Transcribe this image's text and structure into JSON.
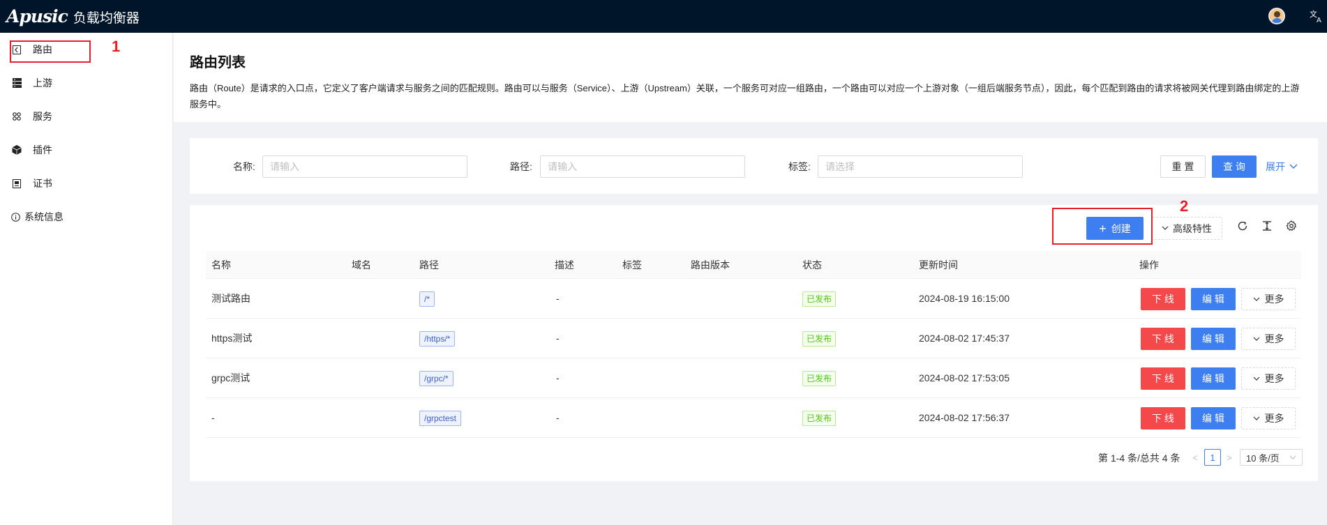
{
  "app": {
    "logo": "Apusic",
    "name": "负载均衡器"
  },
  "header_icons": {
    "avatar": "user-avatar",
    "language": "translate-icon"
  },
  "sidebar": {
    "items": [
      {
        "label": "路由",
        "icon": "route-icon"
      },
      {
        "label": "上游",
        "icon": "server-stack-icon"
      },
      {
        "label": "服务",
        "icon": "apps-icon"
      },
      {
        "label": "插件",
        "icon": "cube-icon"
      },
      {
        "label": "证书",
        "icon": "certificate-icon"
      },
      {
        "label": "系统信息",
        "icon": "info-icon"
      }
    ]
  },
  "annotations": {
    "one": "1",
    "two": "2",
    "color": "#e6202a"
  },
  "page": {
    "title": "路由列表",
    "description": "路由（Route）是请求的入口点，它定义了客户端请求与服务之间的匹配规则。路由可以与服务（Service）、上游（Upstream）关联，一个服务可对应一组路由，一个路由可以对应一个上游对象（一组后端服务节点），因此，每个匹配到路由的请求将被网关代理到路由绑定的上游服务中。"
  },
  "filters": {
    "name_label": "名称:",
    "name_placeholder": "请输入",
    "path_label": "路径:",
    "path_placeholder": "请输入",
    "tag_label": "标签:",
    "tag_placeholder": "请选择",
    "reset": "重 置",
    "query": "查 询",
    "expand": "展开"
  },
  "toolbar": {
    "create": "创建",
    "advanced": "高级特性"
  },
  "table": {
    "columns": [
      "名称",
      "域名",
      "路径",
      "描述",
      "标签",
      "路由版本",
      "状态",
      "更新时间",
      "操作"
    ],
    "rows": [
      {
        "name": "测试路由",
        "host": "",
        "path": "/*",
        "desc": "-",
        "tags": "",
        "version": "",
        "status": "已发布",
        "updated": "2024-08-19 16:15:00"
      },
      {
        "name": "https测试",
        "host": "",
        "path": "/https/*",
        "desc": "-",
        "tags": "",
        "version": "",
        "status": "已发布",
        "updated": "2024-08-02 17:45:37"
      },
      {
        "name": "grpc测试",
        "host": "",
        "path": "/grpc/*",
        "desc": "-",
        "tags": "",
        "version": "",
        "status": "已发布",
        "updated": "2024-08-02 17:53:05"
      },
      {
        "name": "-",
        "host": "",
        "path": "/grpctest",
        "desc": "-",
        "tags": "",
        "version": "",
        "status": "已发布",
        "updated": "2024-08-02 17:56:37"
      }
    ],
    "actions": {
      "offline": "下 线",
      "edit": "编 辑",
      "more": "更多"
    }
  },
  "pagination": {
    "summary": "第 1-4 条/总共 4 条",
    "current_page": "1",
    "page_size": "10 条/页"
  },
  "colors": {
    "primary": "#3d7ef0",
    "danger": "#f5484b",
    "success": "#52c41a",
    "topbar": "#001529"
  }
}
